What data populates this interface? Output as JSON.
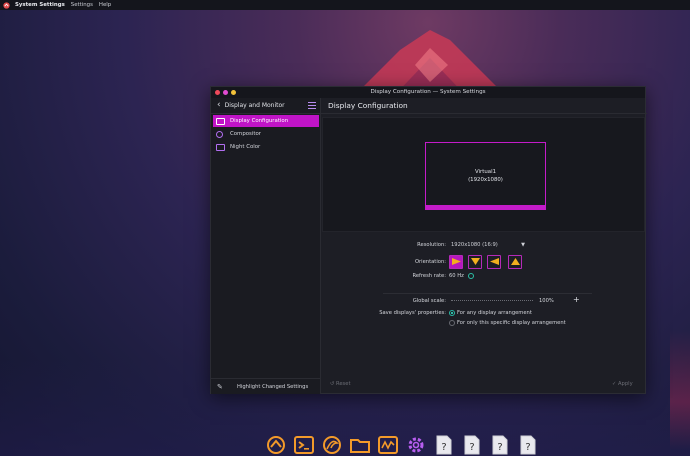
{
  "menubar": {
    "app": "System Settings",
    "items": [
      "Settings",
      "Help"
    ]
  },
  "window": {
    "title": "Display Configuration — System Settings"
  },
  "sidebar": {
    "header": "Display and Monitor",
    "items": [
      {
        "label": "Display Configuration",
        "active": true
      },
      {
        "label": "Compositor",
        "active": false
      },
      {
        "label": "Night Color",
        "active": false
      }
    ],
    "footer": "Highlight Changed Settings"
  },
  "content": {
    "title": "Display Configuration",
    "monitor": {
      "name": "Virtual1",
      "resolution": "(1920x1080)"
    },
    "resolution_label": "Resolution:",
    "resolution_value": "1920x1080 (16:9)",
    "orientation_label": "Orientation:",
    "refresh_label": "Refresh rate:",
    "refresh_value": "60 Hz",
    "scale_label": "Global scale:",
    "scale_value": "100%",
    "save_label": "Save displays' properties:",
    "save_options": [
      "For any display arrangement",
      "For only this specific display arrangement"
    ],
    "reset": "Reset",
    "apply": "Apply"
  },
  "colors": {
    "accent": "#c014c7",
    "radio": "#2bb9a6",
    "icon_orange": "#f2b01e"
  },
  "dock": [
    "system-settings-icon",
    "terminal-icon",
    "browser-icon",
    "files-icon",
    "system-monitor-icon",
    "settings-gear-icon",
    "unknown-app-icon",
    "unknown-app-icon",
    "unknown-app-icon",
    "unknown-app-icon"
  ]
}
